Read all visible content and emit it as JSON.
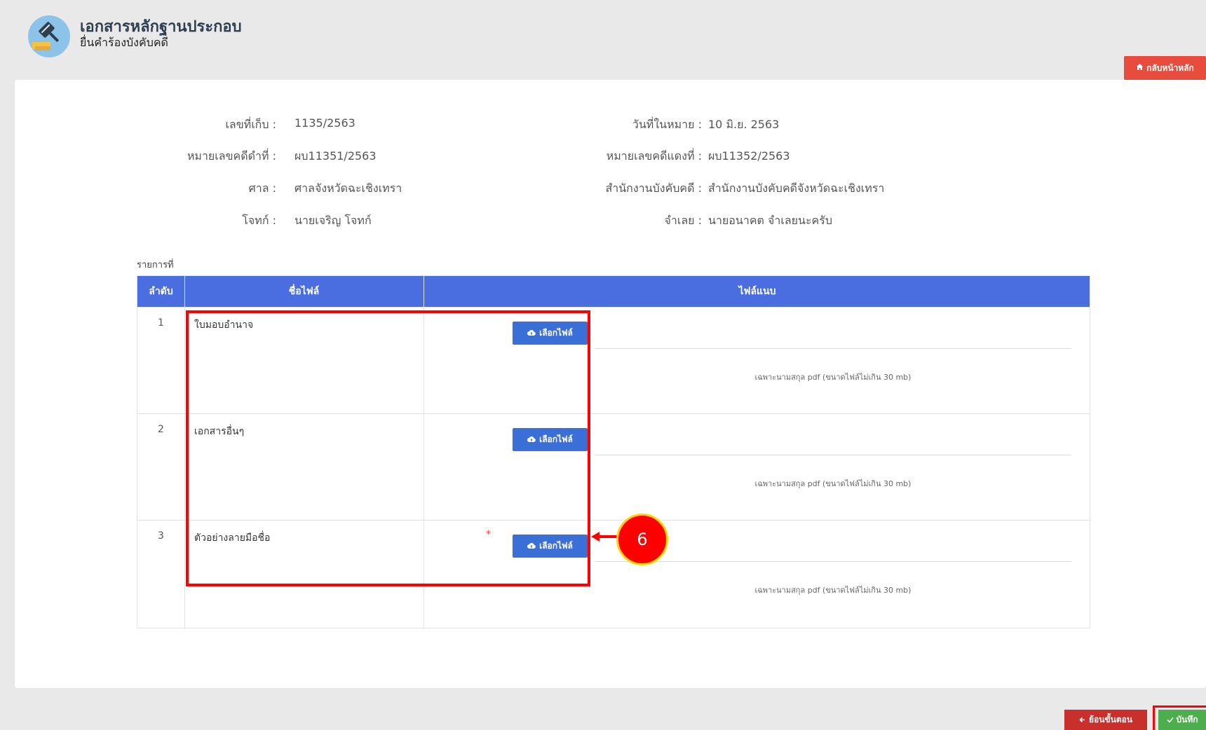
{
  "header": {
    "title": "เอกสารหลักฐานประกอบ",
    "subtitle": "ยื่นคำร้องบังคับคดี",
    "home_button": "กลับหน้าหลัก"
  },
  "info": {
    "left": [
      {
        "label": "เลขที่เก็บ :",
        "value": "1135/2563"
      },
      {
        "label": "หมายเลขคดีดำที่ :",
        "value": "ผบ11351/2563"
      },
      {
        "label": "ศาล :",
        "value": "ศาลจังหวัดฉะเชิงเทรา"
      },
      {
        "label": "โจทก์ :",
        "value": "นายเจริญ โจทก์"
      }
    ],
    "right": [
      {
        "label": "วันที่ในหมาย :",
        "value": "10 มิ.ย. 2563"
      },
      {
        "label": "หมายเลขคดีแดงที่ :",
        "value": "ผบ11352/2563"
      },
      {
        "label": "สำนักงานบังคับคดี :",
        "value": "สำนักงานบังคับคดีจังหวัดฉะเชิงเทรา"
      },
      {
        "label": "จำเลย :",
        "value": "นายอนาคต จำเลยนะครับ"
      }
    ]
  },
  "list_caption": "รายการที่",
  "table": {
    "headers": [
      "ลำดับ",
      "ชื่อไฟล์",
      "ไฟล์แนบ"
    ],
    "choose_label": "เลือกไฟล์",
    "hint": "เฉพาะนามสกุล pdf (ขนาดไฟล์ไม่เกิน 30 mb)",
    "rows": [
      {
        "num": "1",
        "name": "ใบมอบอำนาจ",
        "required": ""
      },
      {
        "num": "2",
        "name": "เอกสารอื่นๆ",
        "required": ""
      },
      {
        "num": "3",
        "name": "ตัวอย่างลายมือชื่อ",
        "required": "*"
      }
    ]
  },
  "annotation": {
    "badge": "6"
  },
  "footer": {
    "back_label": "ย้อนขั้นตอน",
    "save_label": "บันทึก"
  },
  "colors": {
    "header_blue": "#4a6ee0",
    "button_blue": "#3a6fd8",
    "home_red": "#e74c3c",
    "back_red": "#c9302c",
    "save_green": "#4cae4c",
    "annotation_red": "#ff0000"
  }
}
